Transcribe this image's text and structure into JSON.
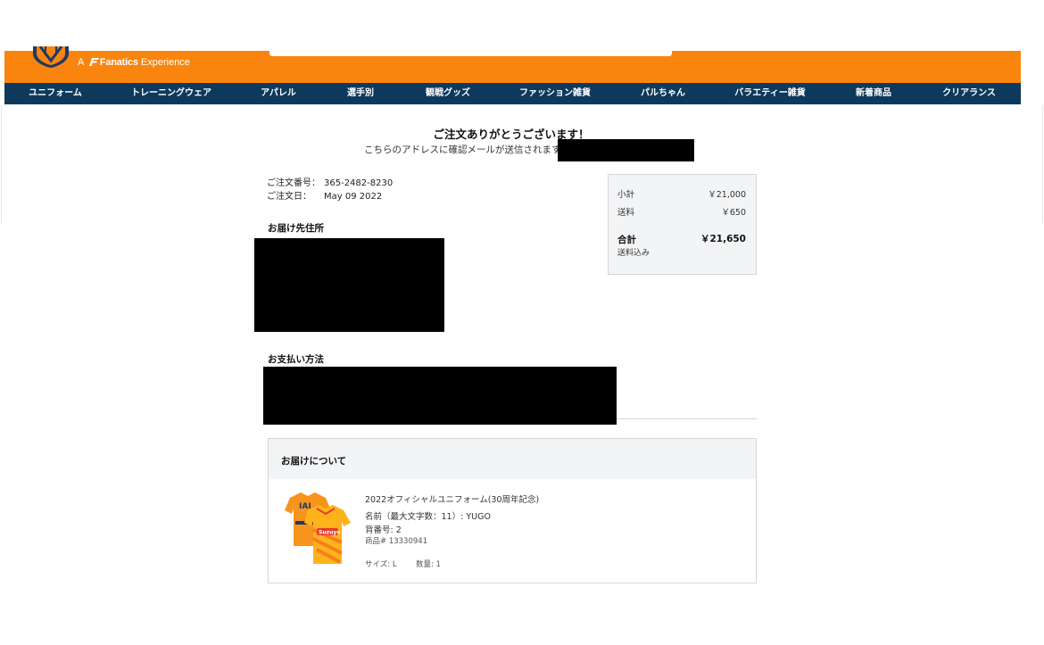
{
  "header": {
    "brand_prefix": "A",
    "brand_name": "Fanatics",
    "brand_suffix": "Experience",
    "logo_icon": "club-crest-icon",
    "accent_color": "#f9850f",
    "nav_color": "#0d3a5c"
  },
  "nav": {
    "items": [
      "ユニフォーム",
      "トレーニングウェア",
      "アパレル",
      "選手別",
      "観戦グッズ",
      "ファッション雑貨",
      "パルちゃん",
      "バラエティー雑貨",
      "新着商品",
      "クリアランス"
    ]
  },
  "confirmation": {
    "thanks": "ご注文ありがとうございます！",
    "email_notice": "こちらのアドレスに確認メールが送信されます："
  },
  "order": {
    "number_label": "ご注文番号：",
    "number": "365-2482-8230",
    "date_label": "ご注文日：",
    "date": "May 09 2022"
  },
  "shipping": {
    "title": "お届け先住所"
  },
  "payment": {
    "title": "お支払い方法"
  },
  "summary": {
    "subtotal_label": "小計",
    "subtotal": "￥21,000",
    "shipping_label": "送料",
    "shipping": "￥650",
    "total_label": "合計",
    "total": "￥21,650",
    "tax_note": "送料込み"
  },
  "delivery": {
    "title": "お届けについて",
    "item": {
      "name": "2022オフィシャルユニフォーム(30周年記念)",
      "custom_name_label": "名前（最大文字数：11）:",
      "custom_name": "YUGO",
      "number_label": "背番号:",
      "number": "2",
      "sku": "商品# 13330941",
      "size_label": "サイズ:",
      "size": "L",
      "qty_label": "数量:",
      "qty": "1",
      "image_icon": "jersey-image"
    }
  }
}
